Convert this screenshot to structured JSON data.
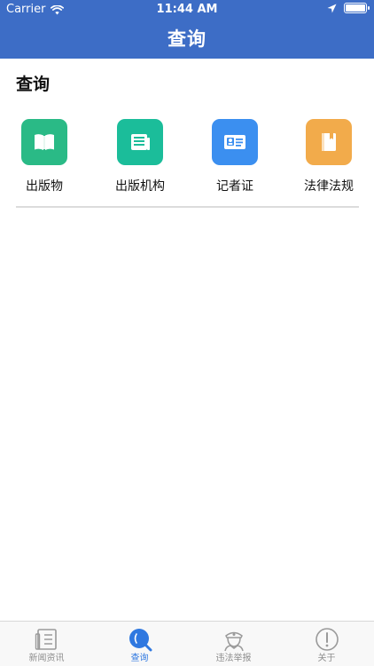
{
  "status_bar": {
    "carrier": "Carrier",
    "time": "11:44 AM"
  },
  "nav": {
    "title": "查询"
  },
  "section": {
    "title": "查询"
  },
  "grid_items": [
    {
      "label": "出版物",
      "icon": "book-icon",
      "color": "#2aba86"
    },
    {
      "label": "出版机构",
      "icon": "newspaper-icon",
      "color": "#1bbd9a"
    },
    {
      "label": "记者证",
      "icon": "id-card-icon",
      "color": "#3b8ff0"
    },
    {
      "label": "法律法规",
      "icon": "law-book-icon",
      "color": "#f2ab4b"
    }
  ],
  "tabs": [
    {
      "label": "新闻资讯",
      "icon": "news-icon",
      "active": false
    },
    {
      "label": "查询",
      "icon": "search-icon",
      "active": true
    },
    {
      "label": "违法举报",
      "icon": "police-icon",
      "active": false
    },
    {
      "label": "关于",
      "icon": "info-icon",
      "active": false
    }
  ],
  "colors": {
    "nav_bg": "#3d6dc6",
    "tab_active": "#2f78e0",
    "tab_inactive": "#8e8e8e"
  }
}
